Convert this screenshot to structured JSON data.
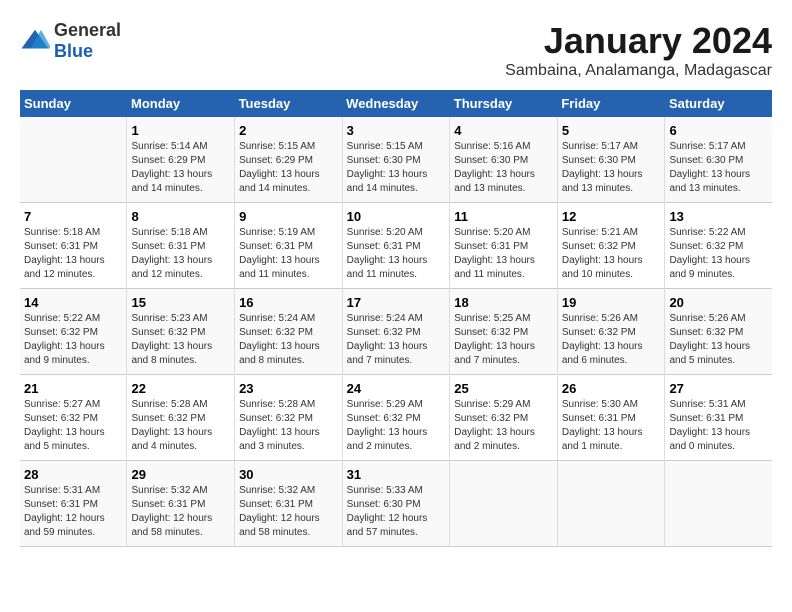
{
  "header": {
    "logo_general": "General",
    "logo_blue": "Blue",
    "main_title": "January 2024",
    "subtitle": "Sambaina, Analamanga, Madagascar"
  },
  "days_of_week": [
    "Sunday",
    "Monday",
    "Tuesday",
    "Wednesday",
    "Thursday",
    "Friday",
    "Saturday"
  ],
  "weeks": [
    [
      {
        "day": "",
        "info": ""
      },
      {
        "day": "1",
        "info": "Sunrise: 5:14 AM\nSunset: 6:29 PM\nDaylight: 13 hours\nand 14 minutes."
      },
      {
        "day": "2",
        "info": "Sunrise: 5:15 AM\nSunset: 6:29 PM\nDaylight: 13 hours\nand 14 minutes."
      },
      {
        "day": "3",
        "info": "Sunrise: 5:15 AM\nSunset: 6:30 PM\nDaylight: 13 hours\nand 14 minutes."
      },
      {
        "day": "4",
        "info": "Sunrise: 5:16 AM\nSunset: 6:30 PM\nDaylight: 13 hours\nand 13 minutes."
      },
      {
        "day": "5",
        "info": "Sunrise: 5:17 AM\nSunset: 6:30 PM\nDaylight: 13 hours\nand 13 minutes."
      },
      {
        "day": "6",
        "info": "Sunrise: 5:17 AM\nSunset: 6:30 PM\nDaylight: 13 hours\nand 13 minutes."
      }
    ],
    [
      {
        "day": "7",
        "info": "Sunrise: 5:18 AM\nSunset: 6:31 PM\nDaylight: 13 hours\nand 12 minutes."
      },
      {
        "day": "8",
        "info": "Sunrise: 5:18 AM\nSunset: 6:31 PM\nDaylight: 13 hours\nand 12 minutes."
      },
      {
        "day": "9",
        "info": "Sunrise: 5:19 AM\nSunset: 6:31 PM\nDaylight: 13 hours\nand 11 minutes."
      },
      {
        "day": "10",
        "info": "Sunrise: 5:20 AM\nSunset: 6:31 PM\nDaylight: 13 hours\nand 11 minutes."
      },
      {
        "day": "11",
        "info": "Sunrise: 5:20 AM\nSunset: 6:31 PM\nDaylight: 13 hours\nand 11 minutes."
      },
      {
        "day": "12",
        "info": "Sunrise: 5:21 AM\nSunset: 6:32 PM\nDaylight: 13 hours\nand 10 minutes."
      },
      {
        "day": "13",
        "info": "Sunrise: 5:22 AM\nSunset: 6:32 PM\nDaylight: 13 hours\nand 9 minutes."
      }
    ],
    [
      {
        "day": "14",
        "info": "Sunrise: 5:22 AM\nSunset: 6:32 PM\nDaylight: 13 hours\nand 9 minutes."
      },
      {
        "day": "15",
        "info": "Sunrise: 5:23 AM\nSunset: 6:32 PM\nDaylight: 13 hours\nand 8 minutes."
      },
      {
        "day": "16",
        "info": "Sunrise: 5:24 AM\nSunset: 6:32 PM\nDaylight: 13 hours\nand 8 minutes."
      },
      {
        "day": "17",
        "info": "Sunrise: 5:24 AM\nSunset: 6:32 PM\nDaylight: 13 hours\nand 7 minutes."
      },
      {
        "day": "18",
        "info": "Sunrise: 5:25 AM\nSunset: 6:32 PM\nDaylight: 13 hours\nand 7 minutes."
      },
      {
        "day": "19",
        "info": "Sunrise: 5:26 AM\nSunset: 6:32 PM\nDaylight: 13 hours\nand 6 minutes."
      },
      {
        "day": "20",
        "info": "Sunrise: 5:26 AM\nSunset: 6:32 PM\nDaylight: 13 hours\nand 5 minutes."
      }
    ],
    [
      {
        "day": "21",
        "info": "Sunrise: 5:27 AM\nSunset: 6:32 PM\nDaylight: 13 hours\nand 5 minutes."
      },
      {
        "day": "22",
        "info": "Sunrise: 5:28 AM\nSunset: 6:32 PM\nDaylight: 13 hours\nand 4 minutes."
      },
      {
        "day": "23",
        "info": "Sunrise: 5:28 AM\nSunset: 6:32 PM\nDaylight: 13 hours\nand 3 minutes."
      },
      {
        "day": "24",
        "info": "Sunrise: 5:29 AM\nSunset: 6:32 PM\nDaylight: 13 hours\nand 2 minutes."
      },
      {
        "day": "25",
        "info": "Sunrise: 5:29 AM\nSunset: 6:32 PM\nDaylight: 13 hours\nand 2 minutes."
      },
      {
        "day": "26",
        "info": "Sunrise: 5:30 AM\nSunset: 6:31 PM\nDaylight: 13 hours\nand 1 minute."
      },
      {
        "day": "27",
        "info": "Sunrise: 5:31 AM\nSunset: 6:31 PM\nDaylight: 13 hours\nand 0 minutes."
      }
    ],
    [
      {
        "day": "28",
        "info": "Sunrise: 5:31 AM\nSunset: 6:31 PM\nDaylight: 12 hours\nand 59 minutes."
      },
      {
        "day": "29",
        "info": "Sunrise: 5:32 AM\nSunset: 6:31 PM\nDaylight: 12 hours\nand 58 minutes."
      },
      {
        "day": "30",
        "info": "Sunrise: 5:32 AM\nSunset: 6:31 PM\nDaylight: 12 hours\nand 58 minutes."
      },
      {
        "day": "31",
        "info": "Sunrise: 5:33 AM\nSunset: 6:30 PM\nDaylight: 12 hours\nand 57 minutes."
      },
      {
        "day": "",
        "info": ""
      },
      {
        "day": "",
        "info": ""
      },
      {
        "day": "",
        "info": ""
      }
    ]
  ]
}
